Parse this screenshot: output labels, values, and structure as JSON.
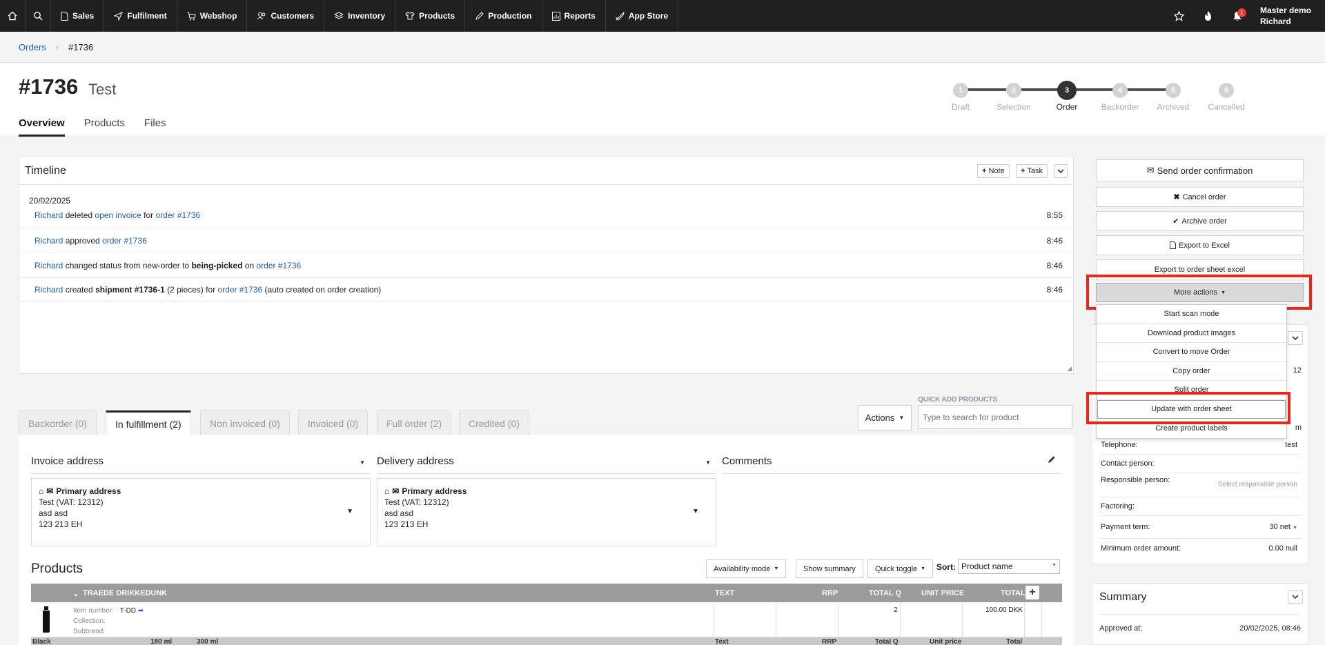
{
  "nav": {
    "items": [
      {
        "label": "Sales",
        "icon": "document-icon"
      },
      {
        "label": "Fulfilment",
        "icon": "send-icon"
      },
      {
        "label": "Webshop",
        "icon": "cart-icon"
      },
      {
        "label": "Customers",
        "icon": "users-icon"
      },
      {
        "label": "Inventory",
        "icon": "layers-icon"
      },
      {
        "label": "Products",
        "icon": "tshirt-icon"
      },
      {
        "label": "Production",
        "icon": "pencil-icon"
      },
      {
        "label": "Reports",
        "icon": "chart-icon"
      },
      {
        "label": "App Store",
        "icon": "rocket-icon"
      }
    ],
    "notification_count": "1",
    "user_company": "Master demo",
    "user_name": "Richard"
  },
  "breadcrumb": {
    "root": "Orders",
    "current": "#1736"
  },
  "order": {
    "number": "#1736",
    "name": "Test"
  },
  "tabs": [
    "Overview",
    "Products",
    "Files"
  ],
  "stepper": {
    "steps": [
      {
        "num": "1",
        "label": "Draft"
      },
      {
        "num": "2",
        "label": "Selection"
      },
      {
        "num": "3",
        "label": "Order"
      },
      {
        "num": "4",
        "label": "Backorder"
      },
      {
        "num": "5",
        "label": "Archived"
      },
      {
        "num": "6",
        "label": "Cancelled"
      }
    ],
    "active_index": 2
  },
  "timeline": {
    "title": "Timeline",
    "note_label": "Note",
    "task_label": "Task",
    "date": "20/02/2025",
    "entries": [
      {
        "user": "Richard",
        "t1": " deleted ",
        "l1": "open invoice",
        "t2": " for ",
        "l2": "order #1736",
        "time": "8:55"
      },
      {
        "user": "Richard",
        "t1": " approved ",
        "l1": "order #1736",
        "time": "8:46"
      },
      {
        "user": "Richard",
        "t1": " changed status from new-order to ",
        "b1": "being-picked",
        "t2": " on ",
        "l2": "order #1736",
        "time": "8:46"
      },
      {
        "user": "Richard",
        "t1": " created ",
        "b1": "shipment #1736-1",
        "t2": " (2 pieces) for ",
        "l2": "order #1736",
        "t3": " (auto created on order creation)",
        "time": "8:46"
      }
    ]
  },
  "status_tabs": [
    "Backorder (0)",
    "In fulfillment (2)",
    "Non invoiced (0)",
    "Invoiced (0)",
    "Full order (2)",
    "Credited (0)"
  ],
  "actions_label": "Actions",
  "quick_add": {
    "label": "QUICK ADD PRODUCTS",
    "placeholder": "Type to search for product"
  },
  "addresses": {
    "invoice_title": "Invoice address",
    "delivery_title": "Delivery address",
    "comments_title": "Comments",
    "invoice": {
      "label": "Primary address",
      "line1": "Test (VAT: 12312)",
      "line2": "asd asd",
      "line3": "123 213 EH"
    },
    "delivery": {
      "label": "Primary address",
      "line1": "Test (VAT: 12312)",
      "line2": "asd asd",
      "line3": "123 213 EH"
    }
  },
  "products": {
    "title": "Products",
    "availability_label": "Availability mode",
    "show_summary_label": "Show summary",
    "quick_toggle_label": "Quick toggle",
    "sort_label": "Sort:",
    "sort_value": "Product name",
    "columns": {
      "name": "TRAEDE DRIKKEDUNK",
      "text": "TEXT",
      "rrp": "RRP",
      "total_q": "TOTAL Q",
      "unit_price": "UNIT PRICE",
      "total": "TOTAL"
    },
    "row": {
      "item_number_label": "Item number:",
      "item_number": "T-DD",
      "collection_label": "Collection:",
      "subbrand_label": "Subbrand:",
      "total_q": "2",
      "total": "100.00 DKK"
    },
    "sub_header": {
      "variant": "Black",
      "size1": "180 ml",
      "size2": "300 ml",
      "text": "Text",
      "rrp": "RRP",
      "total_q": "Total Q",
      "unit_price": "Unit price",
      "total": "Total"
    }
  },
  "sidebar": {
    "send_confirmation": "Send order confirmation",
    "cancel_order": "Cancel order",
    "archive_order": "Archive order",
    "export_excel": "Export to Excel",
    "export_sheet": "Export to order sheet excel",
    "more_actions": "More actions",
    "menu": [
      "Start scan mode",
      "Download product images",
      "Convert to move Order",
      "Copy order",
      "Split order",
      "Update with order sheet",
      "Create product labels"
    ],
    "partial_value_1": "12",
    "partial_value_2": "m",
    "info": [
      {
        "label": "Telephone:",
        "value": "test"
      },
      {
        "label": "Contact person:",
        "value": ""
      },
      {
        "label": "Responsible person:",
        "value": "Select responsible person"
      },
      {
        "label": "Factoring:",
        "value": ""
      },
      {
        "label": "Payment term:",
        "value": "30 net"
      },
      {
        "label": "Minimum order amount:",
        "value": "0.00 null"
      }
    ],
    "summary_title": "Summary",
    "approved_label": "Approved at:",
    "approved_value": "20/02/2025, 08:46"
  },
  "colors": {
    "nav_bg": "#1f1f1f",
    "link": "#1f5ea8",
    "highlight": "#e8261b",
    "stepper_active": "#333333"
  }
}
